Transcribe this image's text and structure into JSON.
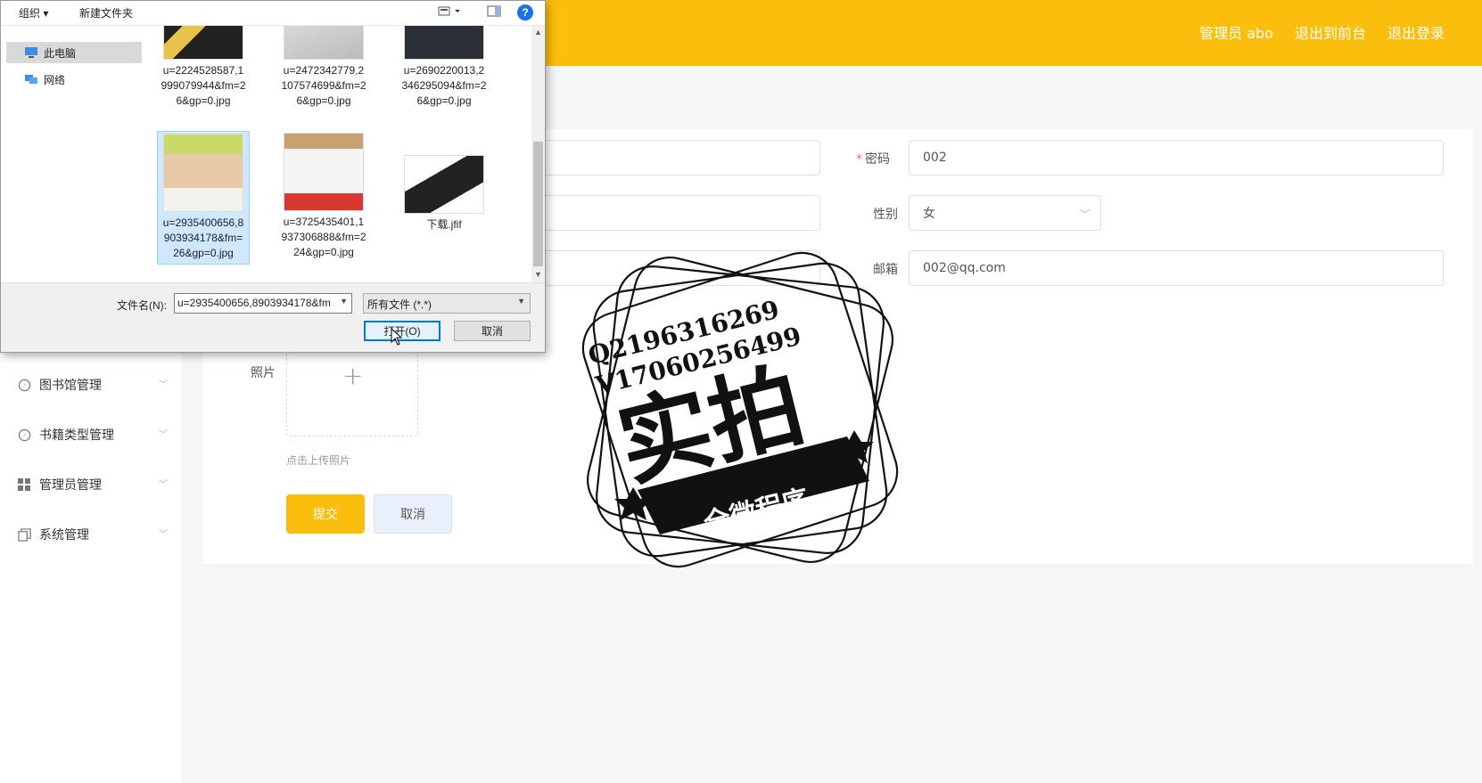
{
  "header": {
    "user": "管理员 abo",
    "to_front": "退出到前台",
    "logout": "退出登录",
    "accent": "#fbbe0d"
  },
  "sidebar": {
    "items": [
      {
        "label": "图书馆管理",
        "icon": "compass-icon"
      },
      {
        "label": "书籍类型管理",
        "icon": "compass-icon"
      },
      {
        "label": "管理员管理",
        "icon": "grid-icon"
      },
      {
        "label": "系统管理",
        "icon": "copy-icon"
      }
    ]
  },
  "form": {
    "password_label": "密码",
    "password_value": "002",
    "gender_label": "性别",
    "gender_value": "女",
    "email_label": "邮箱",
    "email_value": "002@qq.com",
    "photo_label": "照片",
    "upload_hint": "点击上传照片",
    "submit": "提交",
    "cancel": "取消"
  },
  "dialog": {
    "toolbar": {
      "organize": "组织 ▾",
      "new_folder": "新建文件夹",
      "help": "?"
    },
    "nav": [
      {
        "label": "此电脑",
        "icon": "computer-icon"
      },
      {
        "label": "网络",
        "icon": "network-icon"
      }
    ],
    "files": [
      {
        "name": "u=2224528587,1999079944&fm=26&gp=0.jpg"
      },
      {
        "name": "u=2472342779,2107574699&fm=26&gp=0.jpg"
      },
      {
        "name": "u=2690220013,2346295094&fm=26&gp=0.jpg"
      },
      {
        "name": "u=2935400656,8903934178&fm=26&gp=0.jpg"
      },
      {
        "name": "u=3725435401,1937306888&fm=224&gp=0.jpg"
      },
      {
        "name": "下载.jfif"
      }
    ],
    "filename_label": "文件名(N):",
    "filename_value": "u=2935400656,8903934178&fm",
    "filetype": "所有文件 (*.*)",
    "open": "打开(O)",
    "cancel": "取消"
  },
  "watermark": {
    "qq": "Q2196316269",
    "wechat": "V17060256499",
    "title": "实拍",
    "subtitle": "全微程序"
  }
}
